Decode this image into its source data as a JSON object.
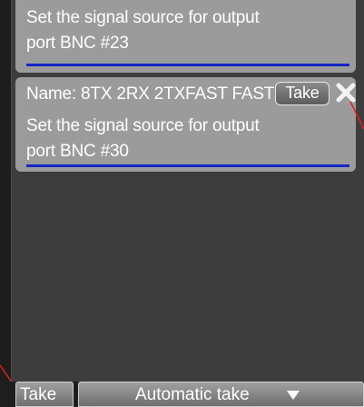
{
  "queue": {
    "items": [
      {
        "description_line1": "Set the signal source for output",
        "description_line2": "port BNC #23"
      },
      {
        "name": "Name: 8TX 2RX 2TXFAST FAST",
        "take_label": "Take",
        "description_line1": "Set the signal source for output",
        "description_line2": "port BNC #30"
      }
    ]
  },
  "footer": {
    "take_label": "Take",
    "automatic_take_label": "Automatic take"
  },
  "icons": {
    "close": "close-icon",
    "dropdown": "caret-down-icon"
  },
  "colors": {
    "panel_bg": "#3d3d3d",
    "item_bg": "#9b9b9b",
    "underline": "#1525c8",
    "connector": "#e02020"
  }
}
